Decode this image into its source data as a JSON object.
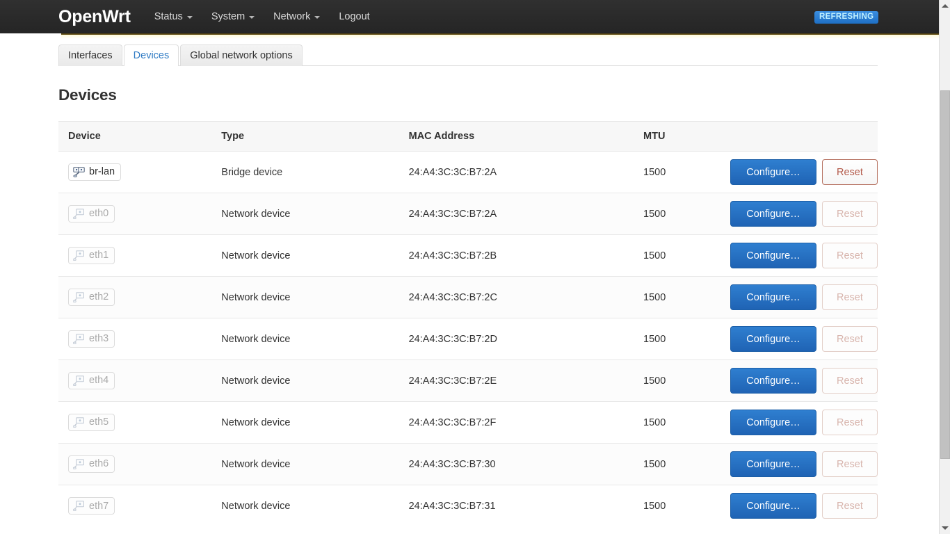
{
  "header": {
    "brand": "OpenWrt",
    "nav": [
      {
        "label": "Status",
        "has_caret": true
      },
      {
        "label": "System",
        "has_caret": true
      },
      {
        "label": "Network",
        "has_caret": true
      },
      {
        "label": "Logout",
        "has_caret": false
      }
    ],
    "status_badge": "REFRESHING",
    "badge_color": "#2a7fd4",
    "badge_text_color": "#bff0ff"
  },
  "tabs": [
    {
      "label": "Interfaces",
      "active": false
    },
    {
      "label": "Devices",
      "active": true
    },
    {
      "label": "Global network options",
      "active": false
    }
  ],
  "main": {
    "title": "Devices",
    "columns": [
      "Device",
      "Type",
      "MAC Address",
      "MTU"
    ],
    "actions": {
      "configure_label": "Configure…",
      "reset_label": "Reset"
    },
    "rows": [
      {
        "device": "br-lan",
        "icon": "bridge-icon",
        "up": true,
        "type": "Bridge device",
        "mac": "24:A4:3C:3C:B7:2A",
        "mtu": "1500",
        "reset_enabled": true
      },
      {
        "device": "eth0",
        "icon": "ethernet-icon",
        "up": false,
        "type": "Network device",
        "mac": "24:A4:3C:3C:B7:2A",
        "mtu": "1500",
        "reset_enabled": false
      },
      {
        "device": "eth1",
        "icon": "ethernet-icon",
        "up": false,
        "type": "Network device",
        "mac": "24:A4:3C:3C:B7:2B",
        "mtu": "1500",
        "reset_enabled": false
      },
      {
        "device": "eth2",
        "icon": "ethernet-icon",
        "up": false,
        "type": "Network device",
        "mac": "24:A4:3C:3C:B7:2C",
        "mtu": "1500",
        "reset_enabled": false
      },
      {
        "device": "eth3",
        "icon": "ethernet-icon",
        "up": false,
        "type": "Network device",
        "mac": "24:A4:3C:3C:B7:2D",
        "mtu": "1500",
        "reset_enabled": false
      },
      {
        "device": "eth4",
        "icon": "ethernet-icon",
        "up": false,
        "type": "Network device",
        "mac": "24:A4:3C:3C:B7:2E",
        "mtu": "1500",
        "reset_enabled": false
      },
      {
        "device": "eth5",
        "icon": "ethernet-icon",
        "up": false,
        "type": "Network device",
        "mac": "24:A4:3C:3C:B7:2F",
        "mtu": "1500",
        "reset_enabled": false
      },
      {
        "device": "eth6",
        "icon": "ethernet-icon",
        "up": false,
        "type": "Network device",
        "mac": "24:A4:3C:3C:B7:30",
        "mtu": "1500",
        "reset_enabled": false
      },
      {
        "device": "eth7",
        "icon": "ethernet-icon",
        "up": false,
        "type": "Network device",
        "mac": "24:A4:3C:3C:B7:31",
        "mtu": "1500",
        "reset_enabled": false
      }
    ]
  },
  "scrollbar": {
    "vertical_present": true
  }
}
